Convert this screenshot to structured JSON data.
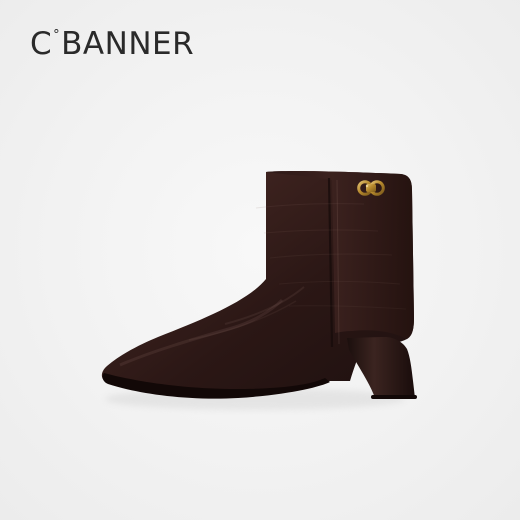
{
  "brand": {
    "prefix": "C",
    "symbol": "°",
    "suffix": "BANNER"
  },
  "product": {
    "image_icon": "ankle-boot-icon",
    "colors": {
      "background": "#f2f2f2",
      "leather_dark": "#2b1715",
      "leather_mid": "#4a2b26",
      "leather_highlight": "#7a5a53",
      "hardware_gold": "#b78a2d",
      "shadow": "#c9c9c9"
    }
  }
}
